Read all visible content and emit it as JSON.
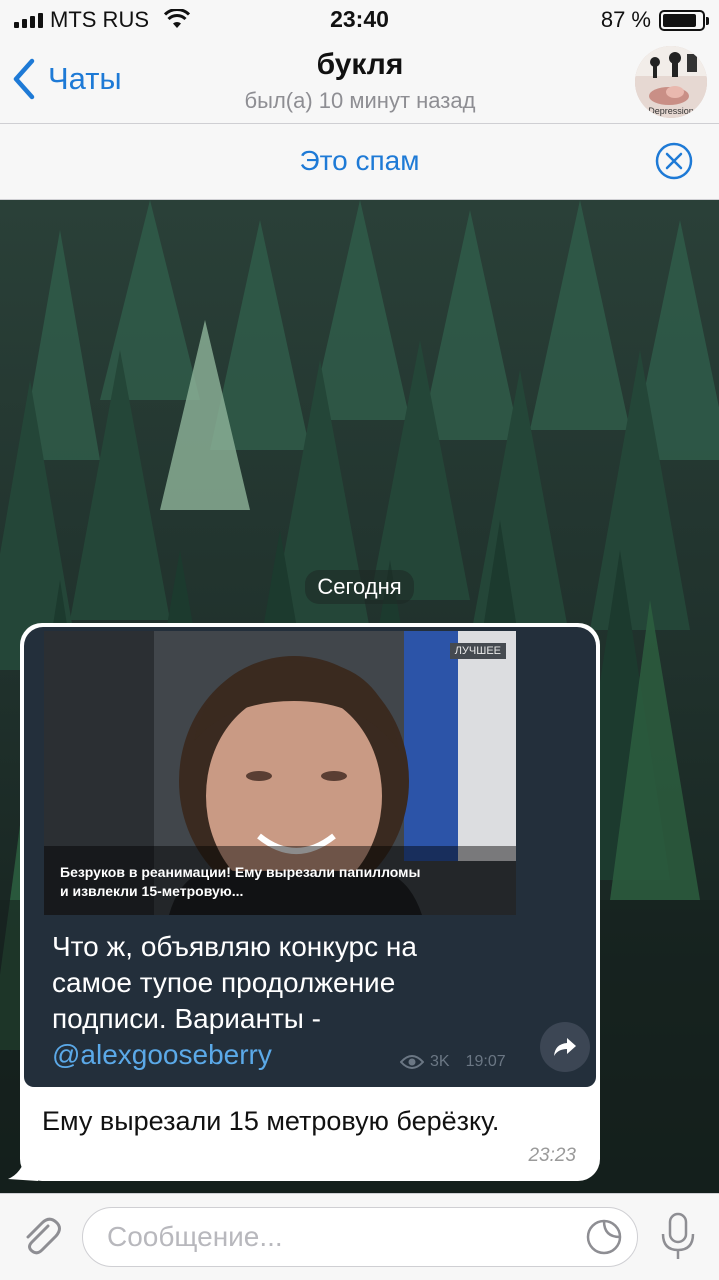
{
  "status_bar": {
    "carrier": "MTS RUS",
    "time": "23:40",
    "battery_pct": "87 %",
    "battery_level": 0.87
  },
  "nav": {
    "back_label": "Чаты",
    "title": "букля",
    "subtitle": "был(а) 10 минут назад",
    "avatar_text": "Depression"
  },
  "spam_bar": {
    "label": "Это спам"
  },
  "chat": {
    "date": "Сегодня",
    "message": {
      "forward": {
        "photo_tag": "ЛУЧШЕЕ",
        "headline_1": "Безруков в реанимации! Ему вырезали папилломы",
        "headline_2": "и извлекли 15-метровую...",
        "text_1": "Что ж, объявляю конкурс на",
        "text_2": "самое тупое продолжение",
        "text_3": "подписи. Варианты -",
        "link": "@alexgooseberry",
        "views": "3K",
        "time": "19:07"
      },
      "text": "Ему вырезали 15 метровую берёзку.",
      "time": "23:23"
    }
  },
  "input": {
    "placeholder": "Сообщение..."
  },
  "colors": {
    "accent": "#1e7ad6",
    "link": "#5ba9e8",
    "forward_bg": "#232f3b"
  }
}
